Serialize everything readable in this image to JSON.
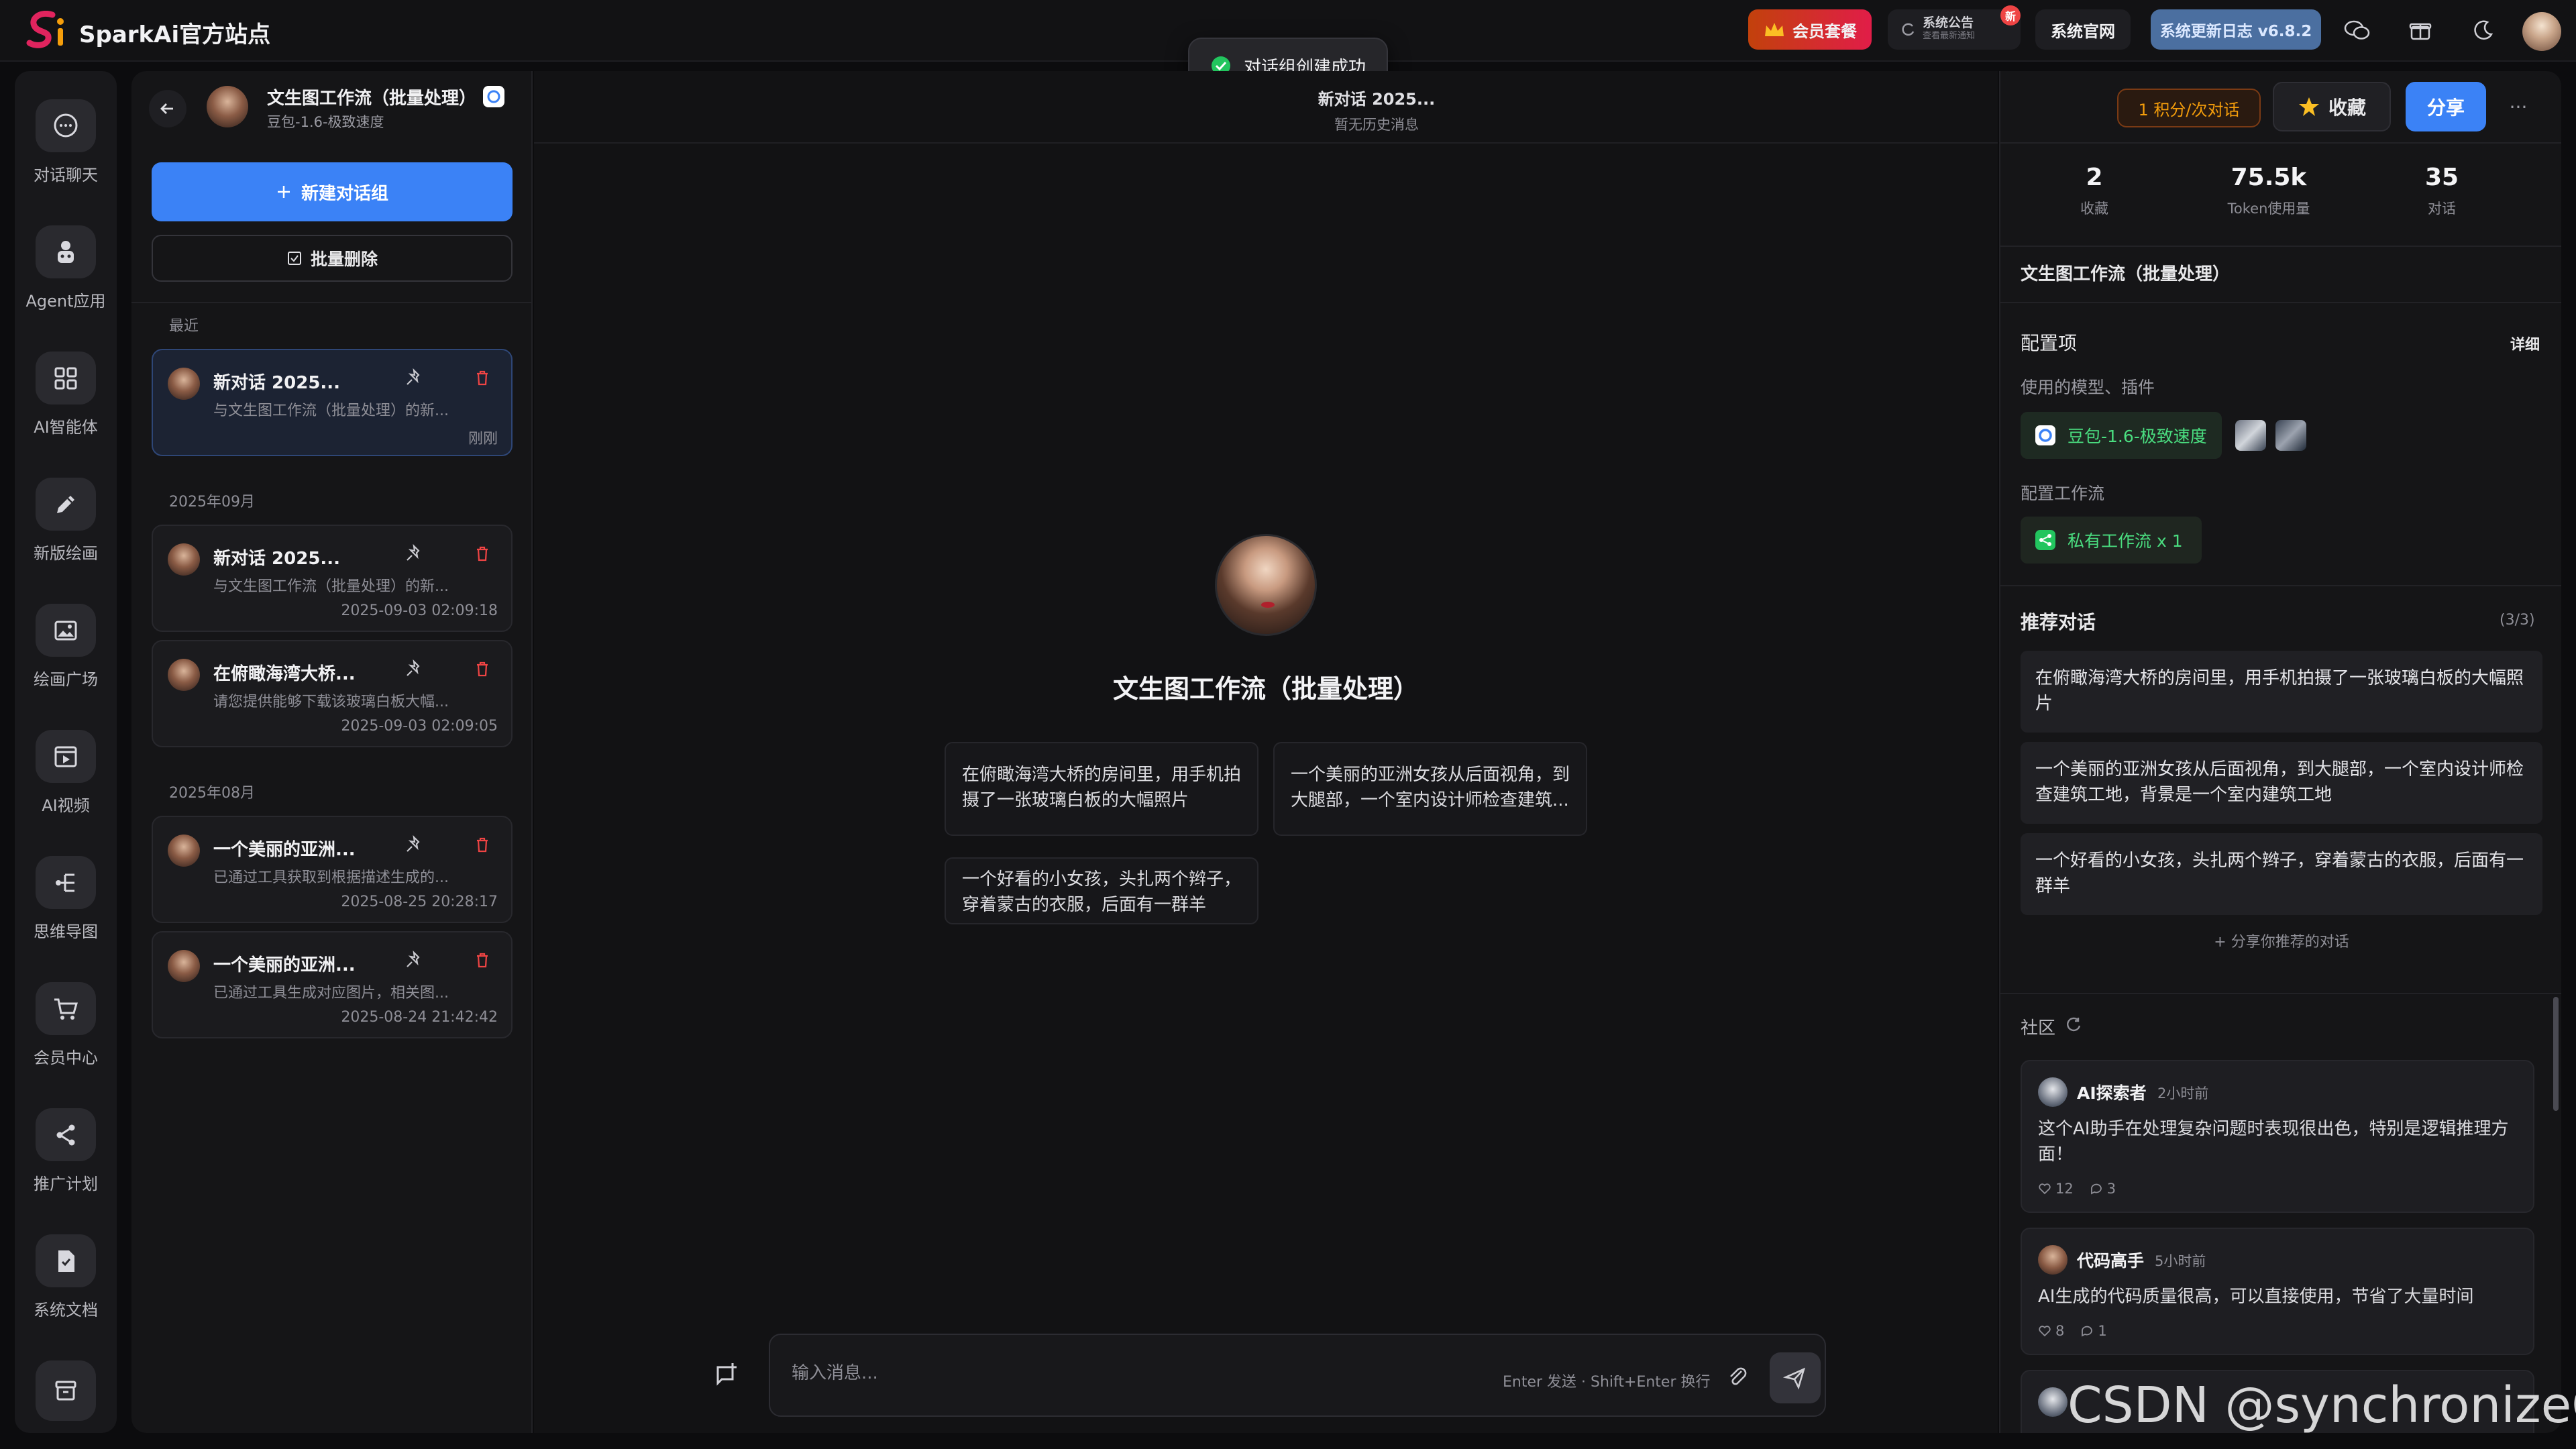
{
  "app": {
    "brand": "SparkAi官方站点"
  },
  "topbar": {
    "vip_label": "会员套餐",
    "notice_label": "系统公告",
    "notice_sub": "查看最新通知",
    "notice_badge": "新",
    "official_label": "系统官网",
    "changelog_label": "系统更新日志 v6.8.2"
  },
  "toast": {
    "message": "对话组创建成功"
  },
  "nav": {
    "items": [
      {
        "label": "对话聊天",
        "icon": "chat-icon"
      },
      {
        "label": "Agent应用",
        "icon": "agent-icon"
      },
      {
        "label": "AI智能体",
        "icon": "grid-icon"
      },
      {
        "label": "新版绘画",
        "icon": "pen-icon"
      },
      {
        "label": "绘画广场",
        "icon": "gallery-icon"
      },
      {
        "label": "AI视频",
        "icon": "video-icon"
      },
      {
        "label": "思维导图",
        "icon": "mindmap-icon"
      },
      {
        "label": "会员中心",
        "icon": "cart-icon"
      },
      {
        "label": "推广计划",
        "icon": "share-icon"
      },
      {
        "label": "系统文档",
        "icon": "doc-icon"
      }
    ]
  },
  "panel": {
    "title": "文生图工作流（批量处理）",
    "model": "豆包-1.6-极致速度",
    "new_group": "新建对话组",
    "batch_delete": "批量删除",
    "groups": [
      {
        "label": "最近",
        "items": [
          {
            "title": "新对话 2025...",
            "preview": "与文生图工作流（批量处理）的新...",
            "time": "刚刚",
            "active": true
          }
        ]
      },
      {
        "label": "2025年09月",
        "items": [
          {
            "title": "新对话 2025...",
            "preview": "与文生图工作流（批量处理）的新...",
            "time": "2025-09-03 02:09:18"
          },
          {
            "title": "在俯瞰海湾大桥...",
            "preview": "请您提供能够下载该玻璃白板大幅...",
            "time": "2025-09-03 02:09:05"
          }
        ]
      },
      {
        "label": "2025年08月",
        "items": [
          {
            "title": "一个美丽的亚洲...",
            "preview": "已通过工具获取到根据描述生成的...",
            "time": "2025-08-25 20:28:17"
          },
          {
            "title": "一个美丽的亚洲...",
            "preview": "已通过工具生成对应图片，相关图...",
            "time": "2025-08-24 21:42:42"
          }
        ]
      }
    ]
  },
  "center": {
    "conv_title": "新对话 2025...",
    "conv_sub": "暂无历史消息",
    "title": "文生图工作流（批量处理）",
    "suggestions": [
      "在俯瞰海湾大桥的房间里，用手机拍摄了一张玻璃白板的大幅照片",
      "一个美丽的亚洲女孩从后面视角，到大腿部，一个室内设计师检查建筑...",
      "一个好看的小女孩，头扎两个辫子，穿着蒙古的衣服，后面有一群羊"
    ],
    "input_placeholder": "输入消息...",
    "input_hint": "Enter 发送 · Shift+Enter 换行"
  },
  "right": {
    "cost": "1 积分/次对话",
    "favorite": "收藏",
    "share": "分享",
    "more": "···",
    "stats": [
      {
        "value": "2",
        "label": "收藏"
      },
      {
        "value": "75.5k",
        "label": "Token使用量"
      },
      {
        "value": "35",
        "label": "对话"
      }
    ],
    "app_title": "文生图工作流（批量处理）",
    "config_title": "配置项",
    "config_detail": "详细",
    "models_label": "使用的模型、插件",
    "model_chip": "豆包-1.6-极致速度",
    "workflow_label": "配置工作流",
    "workflow_chip": "私有工作流 x 1",
    "rec_title": "推荐对话",
    "rec_count": "(3/3)",
    "recs": [
      "在俯瞰海湾大桥的房间里，用手机拍摄了一张玻璃白板的大幅照片",
      "一个美丽的亚洲女孩从后面视角，到大腿部，一个室内设计师检查建筑工地，背景是一个室内建筑工地",
      "一个好看的小女孩，头扎两个辫子，穿着蒙古的衣服，后面有一群羊"
    ],
    "share_rec": "+ 分享你推荐的对话",
    "community_title": "社区",
    "posts": [
      {
        "name": "AI探索者",
        "time": "2小时前",
        "text": "这个AI助手在处理复杂问题时表现很出色，特别是逻辑推理方面！",
        "likes": "12",
        "comments": "3"
      },
      {
        "name": "代码高手",
        "time": "5小时前",
        "text": "AI生成的代码质量很高，可以直接使用，节省了大量时间",
        "likes": "8",
        "comments": "1"
      }
    ]
  },
  "watermark": "CSDN @synchronizeOn"
}
